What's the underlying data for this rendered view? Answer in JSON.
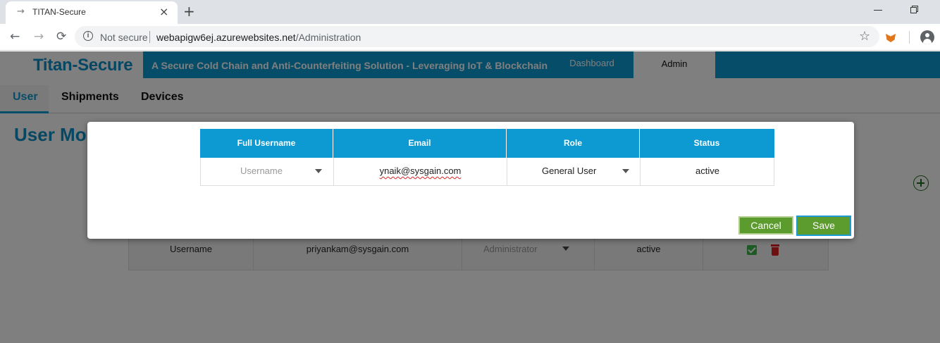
{
  "browser": {
    "tab_title": "TITAN-Secure",
    "tab_favicon": "→",
    "close_symbol": "×",
    "newtab_symbol": "+",
    "not_secure": "Not secure",
    "url_host": "webapigw6ej.azurewebsites.net",
    "url_path": "/Administration"
  },
  "header": {
    "logo": "Titan-Secure",
    "tagline": "A Secure Cold Chain and Anti-Counterfeiting Solution - Leveraging IoT & Blockchain",
    "nav": {
      "dashboard": "Dashboard",
      "admin": "Admin"
    }
  },
  "subtabs": {
    "user": "User",
    "shipments": "Shipments",
    "devices": "Devices"
  },
  "page": {
    "title": "User Mo"
  },
  "background_row": {
    "username": "Username",
    "email": "priyankam@sysgain.com",
    "role": "Administrator",
    "status": "active"
  },
  "modal": {
    "headers": {
      "full_username": "Full Username",
      "email": "Email",
      "role": "Role",
      "status": "Status"
    },
    "row": {
      "username_placeholder": "Username",
      "email": "ynaik@sysgain.com",
      "role": "General User",
      "status": "active"
    },
    "cancel_label": "Cancel",
    "save_label": "Save"
  },
  "colors": {
    "header_blue": "#0d9ad3",
    "button_green": "#5c9b2e",
    "delete_red": "#d9231f",
    "check_green": "#3bb54a"
  },
  "icons": [
    "info-icon",
    "star-icon",
    "extension-icon",
    "profile-icon",
    "add-user-icon",
    "check-icon",
    "trash-icon",
    "caret-down-icon"
  ]
}
